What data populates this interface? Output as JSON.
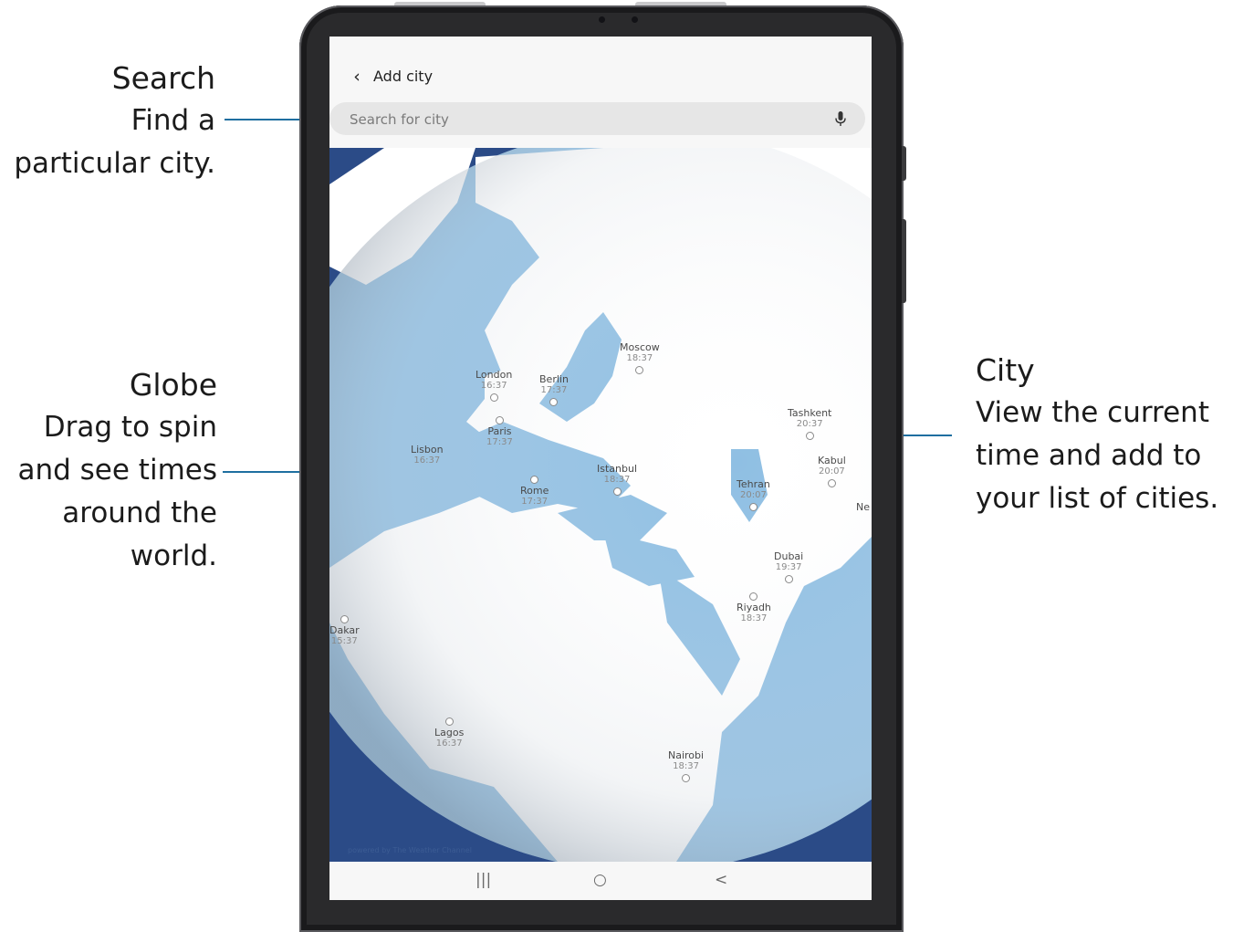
{
  "callouts": {
    "search": {
      "title": "Search",
      "line1": "Find a",
      "line2": "particular city."
    },
    "globe": {
      "title": "Globe",
      "line1": "Drag to spin",
      "line2": "and see times",
      "line3": "around the",
      "line4": "world."
    },
    "city": {
      "title": "City",
      "line1": "View the current",
      "line2": "time and add to",
      "line3": "your list of cities."
    }
  },
  "colors": {
    "accent": "#1f6fa0",
    "ocean": "#8fbfe3",
    "land": "#ffffff",
    "space": "#2b4b87"
  },
  "header": {
    "back_icon": "back-chevron-icon",
    "title": "Add city"
  },
  "search": {
    "placeholder": "Search for city",
    "mic_icon": "microphone-icon"
  },
  "cities": [
    {
      "name": "Moscow",
      "time": "18:37"
    },
    {
      "name": "London",
      "time": "16:37"
    },
    {
      "name": "Berlin",
      "time": "17:37"
    },
    {
      "name": "Paris",
      "time": "17:37"
    },
    {
      "name": "Lisbon",
      "time": "16:37"
    },
    {
      "name": "Istanbul",
      "time": "18:37"
    },
    {
      "name": "Rome",
      "time": "17:37"
    },
    {
      "name": "Tashkent",
      "time": "20:37"
    },
    {
      "name": "Kabul",
      "time": "20:07"
    },
    {
      "name": "Tehran",
      "time": "20:07"
    },
    {
      "name": "Dubai",
      "time": "19:37"
    },
    {
      "name": "Riyadh",
      "time": "18:37"
    },
    {
      "name": "Dakar",
      "time": "15:37"
    },
    {
      "name": "Lagos",
      "time": "16:37"
    },
    {
      "name": "Nairobi",
      "time": "18:37"
    },
    {
      "name": "Ne",
      "time": ""
    }
  ],
  "powered_by": "powered by The Weather Channel",
  "navbar": {
    "recents": "|||",
    "home": "○",
    "back": "<"
  }
}
